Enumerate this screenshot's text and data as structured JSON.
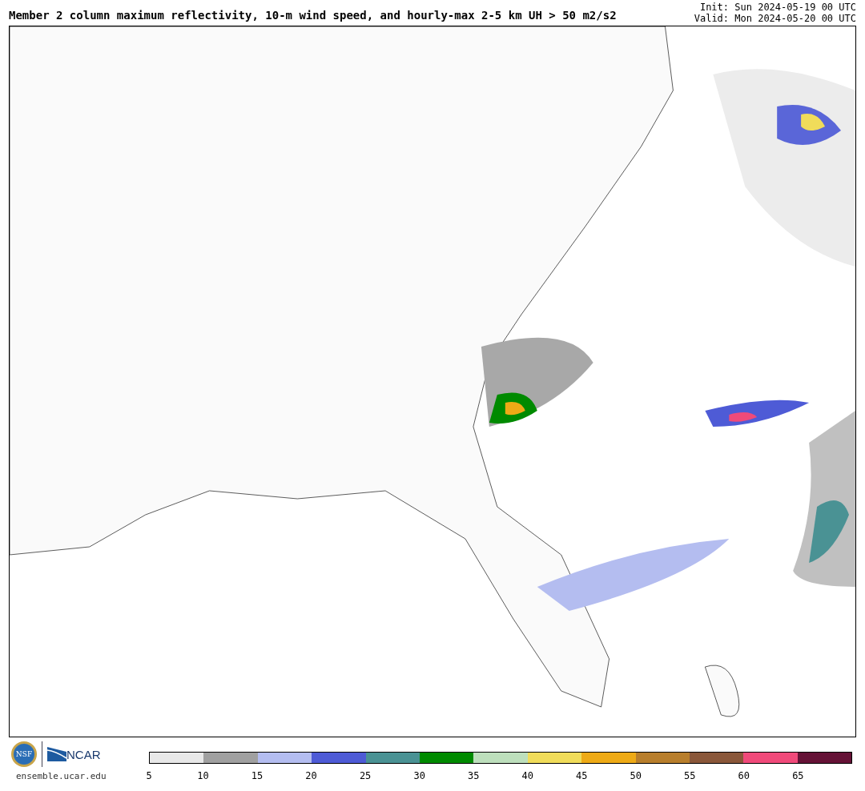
{
  "header": {
    "title": "Member 2 column maximum reflectivity, 10-m wind speed, and hourly-max 2-5 km UH > 50 m2/s2",
    "init": "Init: Sun 2024-05-19 00 UTC",
    "valid": "Valid: Mon 2024-05-20 00 UTC"
  },
  "footer": {
    "logo_left": "NSF",
    "logo_right": "NCAR",
    "site": "ensemble.ucar.edu",
    "colorbar": [
      {
        "color": "#e8e8e8",
        "label": "5"
      },
      {
        "color": "#a0a0a0",
        "label": "10"
      },
      {
        "color": "#b4bdf0",
        "label": "15"
      },
      {
        "color": "#4e5bd6",
        "label": "20"
      },
      {
        "color": "#4a9294",
        "label": "25"
      },
      {
        "color": "#008a00",
        "label": "30"
      },
      {
        "color": "#bddfbc",
        "label": "35"
      },
      {
        "color": "#f0dc5a",
        "label": "40"
      },
      {
        "color": "#eeaa16",
        "label": "45"
      },
      {
        "color": "#b87e2c",
        "label": "50"
      },
      {
        "color": "#8a573a",
        "label": "55"
      },
      {
        "color": "#f04a7a",
        "label": "60"
      },
      {
        "color": "#651236",
        "label": "65"
      }
    ]
  }
}
